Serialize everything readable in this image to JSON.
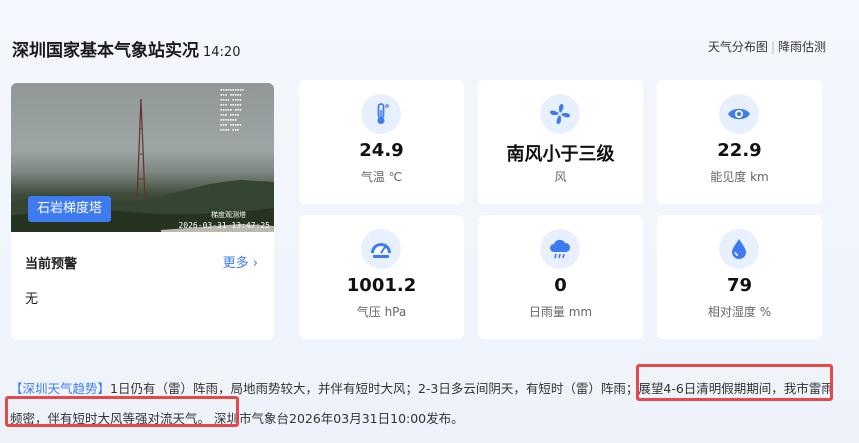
{
  "header": {
    "title": "深圳国家基本气象站实况",
    "time": "14:20",
    "links": [
      "天气分布图",
      "降雨估测"
    ]
  },
  "webcam": {
    "location_tag": "石岩梯度塔",
    "timestamp": "2026-03-31 13:47:25",
    "camera_label": "梯度观测塔"
  },
  "warning": {
    "title": "当前预警",
    "more": "更多",
    "value": "无"
  },
  "tiles": [
    {
      "value": "24.9",
      "label": "气温 ℃",
      "icon": "thermometer-icon"
    },
    {
      "value": "南风小于三级",
      "label": "风",
      "icon": "fan-icon"
    },
    {
      "value": "22.9",
      "label": "能见度 km",
      "icon": "eye-icon"
    },
    {
      "value": "1001.2",
      "label": "气压 hPa",
      "icon": "gauge-icon"
    },
    {
      "value": "0",
      "label": "日雨量 mm",
      "icon": "rain-cloud-icon"
    },
    {
      "value": "79",
      "label": "相对湿度 %",
      "icon": "water-drop-icon"
    }
  ],
  "forecast": {
    "tag": "【深圳天气趋势】",
    "part1": "1日仍有（雷）阵雨，局地雨势较大，并伴有短时大风；2-3日多云间阴天，有短时（雷）阵雨；",
    "part2": "展望4-6日清明假期期间，我市雷雨频密，伴有短时大风等强对流天气。",
    "publisher": " 深圳市气象台2026年03月31日10:00发布。"
  },
  "colors": {
    "accent": "#3f7bf0",
    "highlight": "#e8484a",
    "icon_bg": "#e8effd"
  }
}
